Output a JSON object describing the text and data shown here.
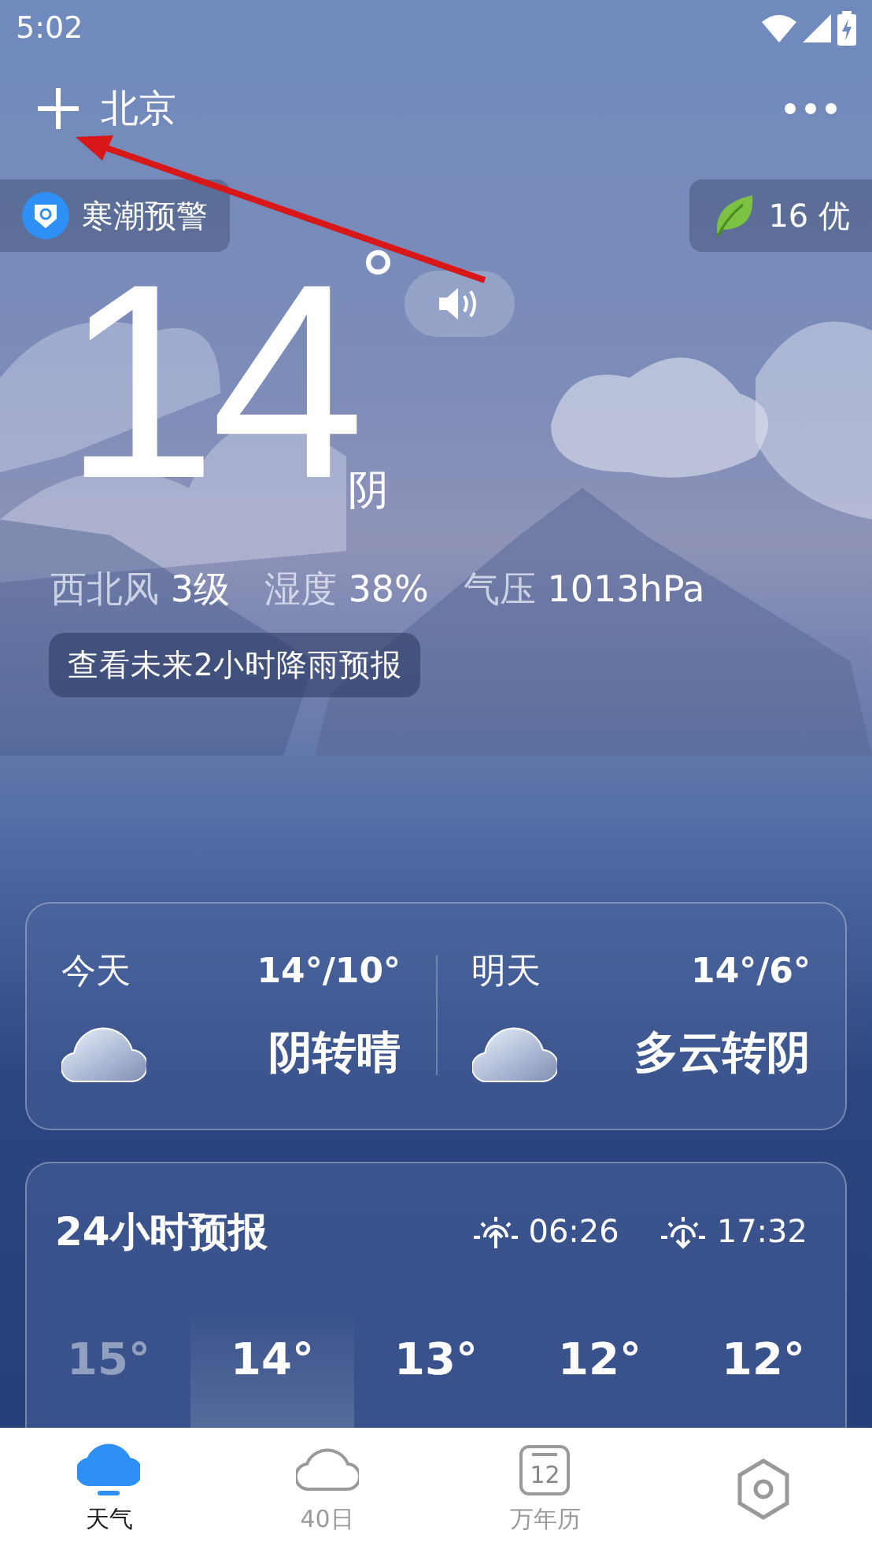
{
  "status_bar": {
    "time": "5:02"
  },
  "header": {
    "city": "北京"
  },
  "alert": {
    "label": "寒潮预警"
  },
  "air_quality": {
    "label": "16 优"
  },
  "current": {
    "temperature": "14",
    "degree": "°",
    "condition": "阴"
  },
  "metrics": [
    {
      "name": "西北风",
      "value": "3级"
    },
    {
      "name": "湿度",
      "value": "38%"
    },
    {
      "name": "气压",
      "value": "1013hPa"
    }
  ],
  "rain_forecast_button": "查看未来2小时降雨预报",
  "days": [
    {
      "day": "今天",
      "range": "14°/10°",
      "condition": "阴转晴"
    },
    {
      "day": "明天",
      "range": "14°/6°",
      "condition": "多云转阴"
    }
  ],
  "hourly": {
    "title": "24小时预报",
    "sunrise": "06:26",
    "sunset": "17:32",
    "hours": [
      {
        "temp": "15°",
        "selected": false,
        "past": true
      },
      {
        "temp": "14°",
        "selected": true,
        "past": false
      },
      {
        "temp": "13°",
        "selected": false,
        "past": false
      },
      {
        "temp": "12°",
        "selected": false,
        "past": false
      },
      {
        "temp": "12°",
        "selected": false,
        "past": false
      }
    ]
  },
  "tabs": [
    {
      "kind": "weather",
      "label": "天气",
      "selected": true
    },
    {
      "kind": "forecast40",
      "label": "40日",
      "selected": false
    },
    {
      "kind": "calendar",
      "label": "万年历",
      "icon_text": "12",
      "selected": false
    },
    {
      "kind": "other",
      "selected": false
    }
  ]
}
